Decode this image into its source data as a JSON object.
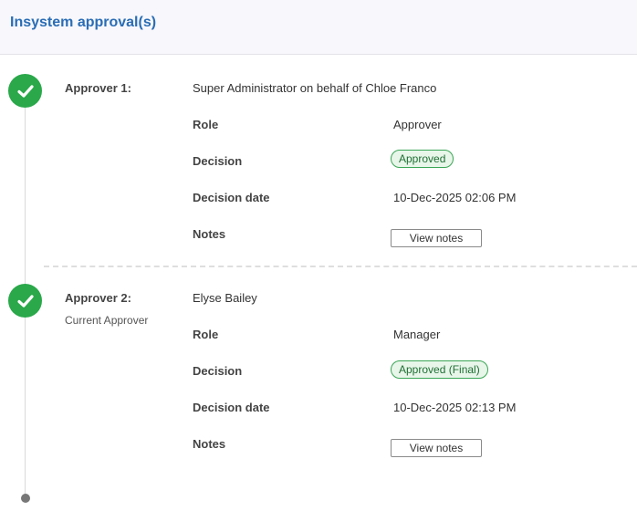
{
  "header": {
    "title": "Insystem approval(s)"
  },
  "approvers": [
    {
      "label": "Approver 1:",
      "subtitle": "",
      "name": "Super Administrator on behalf of Chloe Franco",
      "role_label": "Role",
      "role": "Approver",
      "decision_label": "Decision",
      "decision": "Approved",
      "decision_date_label": "Decision date",
      "decision_date": "10-Dec-2025 02:06 PM",
      "notes_label": "Notes",
      "notes_button": "View notes"
    },
    {
      "label": "Approver 2:",
      "subtitle": "Current Approver",
      "name": "Elyse Bailey",
      "role_label": "Role",
      "role": "Manager",
      "decision_label": "Decision",
      "decision": "Approved (Final)",
      "decision_date_label": "Decision date",
      "decision_date": "10-Dec-2025 02:13 PM",
      "notes_label": "Notes",
      "notes_button": "View notes"
    }
  ],
  "colors": {
    "title": "#2a6db5",
    "check": "#2aa84a",
    "badge_border": "#3aa655",
    "badge_bg": "#e8f6ea"
  },
  "icons": {
    "step_done": "check-icon",
    "timeline_end": "dot-icon"
  }
}
